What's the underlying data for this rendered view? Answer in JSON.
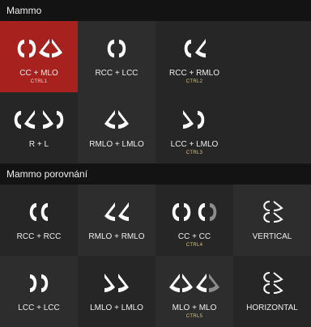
{
  "sections": [
    {
      "title": "Mammo",
      "tiles": [
        {
          "label": "CC + MLO",
          "shortcut": "CTRL1",
          "icon": "cc-mlo-icon"
        },
        {
          "label": "RCC + LCC",
          "shortcut": "",
          "icon": "rcc-lcc-icon"
        },
        {
          "label": "RCC + RMLO",
          "shortcut": "CTRL2",
          "icon": "rcc-rmlo-icon"
        },
        {
          "label": "R + L",
          "shortcut": "",
          "icon": "r-l-icon"
        },
        {
          "label": "RMLO + LMLO",
          "shortcut": "",
          "icon": "rmlo-lmlo-icon"
        },
        {
          "label": "LCC + LMLO",
          "shortcut": "CTRL3",
          "icon": "lcc-lmlo-icon"
        }
      ]
    },
    {
      "title": "Mammo porovnání",
      "tiles": [
        {
          "label": "RCC + RCC",
          "shortcut": "",
          "icon": "rcc-rcc-icon"
        },
        {
          "label": "RMLO + RMLO",
          "shortcut": "",
          "icon": "rmlo-rmlo-icon"
        },
        {
          "label": "CC + CC",
          "shortcut": "CTRL4",
          "icon": "cc-cc-icon"
        },
        {
          "label": "VERTICAL",
          "shortcut": "",
          "icon": "vertical-icon"
        },
        {
          "label": "LCC + LCC",
          "shortcut": "",
          "icon": "lcc-lcc-icon"
        },
        {
          "label": "LMLO + LMLO",
          "shortcut": "",
          "icon": "lmlo-lmlo-icon"
        },
        {
          "label": "MLO + MLO",
          "shortcut": "CTRL5",
          "icon": "mlo-mlo-icon"
        },
        {
          "label": "HORIZONTAL",
          "shortcut": "",
          "icon": "horizontal-icon"
        }
      ]
    }
  ],
  "colors": {
    "active": "#a7221e",
    "shortcut": "#d8c27a",
    "header": "#131313"
  }
}
